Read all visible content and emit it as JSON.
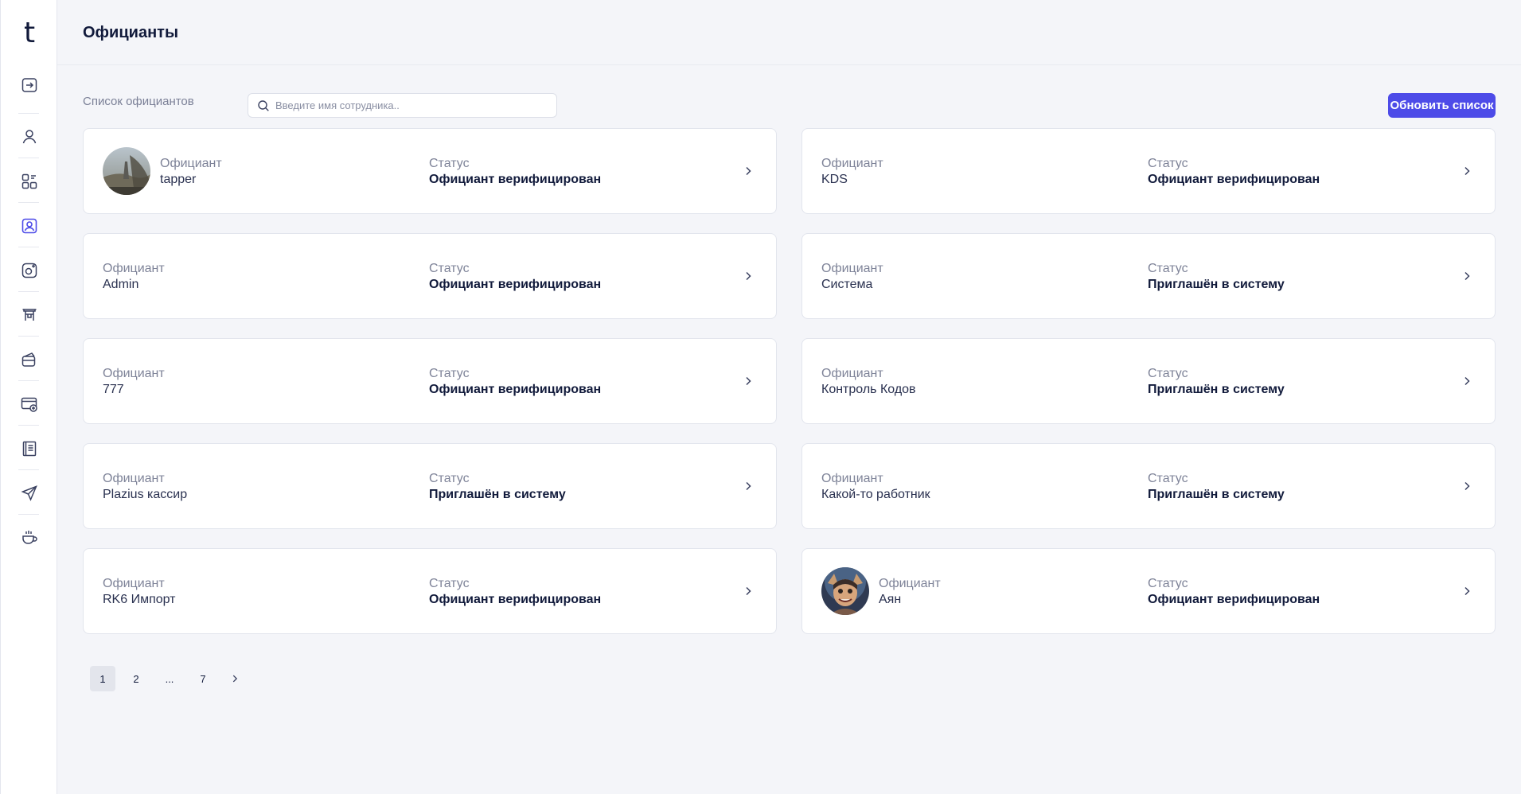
{
  "app": {
    "logo": "t"
  },
  "header": {
    "title": "Официанты"
  },
  "toolbar": {
    "list_label": "Список официантов",
    "search_placeholder": "Введите имя сотрудника..",
    "refresh_label": "Обновить список"
  },
  "sidebar": {
    "items": [
      {
        "icon": "logout-icon"
      },
      {
        "icon": "user-icon"
      },
      {
        "icon": "dashboard-icon"
      },
      {
        "icon": "waiters-icon",
        "active": true
      },
      {
        "icon": "restaurant-settings-icon"
      },
      {
        "icon": "tables-icon"
      },
      {
        "icon": "payments-icon"
      },
      {
        "icon": "card-add-icon"
      },
      {
        "icon": "menu-book-icon"
      },
      {
        "icon": "send-icon"
      },
      {
        "icon": "cup-icon"
      }
    ]
  },
  "cards": [
    {
      "label": "Официант",
      "name": "tapper",
      "status_label": "Статус",
      "status": "Официант верифицирован",
      "avatar": "photo-bench"
    },
    {
      "label": "Официант",
      "name": "KDS",
      "status_label": "Статус",
      "status": "Официант верифицирован"
    },
    {
      "label": "Официант",
      "name": "Admin",
      "status_label": "Статус",
      "status": "Официант верифицирован"
    },
    {
      "label": "Официант",
      "name": "Система",
      "status_label": "Статус",
      "status": "Приглашён в систему"
    },
    {
      "label": "Официант",
      "name": "777",
      "status_label": "Статус",
      "status": "Официант верифицирован"
    },
    {
      "label": "Официант",
      "name": "Контроль Кодов",
      "status_label": "Статус",
      "status": "Приглашён в систему"
    },
    {
      "label": "Официант",
      "name": "Plazius кассир",
      "status_label": "Статус",
      "status": "Приглашён в систему"
    },
    {
      "label": "Официант",
      "name": "Какой-то работник",
      "status_label": "Статус",
      "status": "Приглашён в систему"
    },
    {
      "label": "Официант",
      "name": "RK6 Импорт",
      "status_label": "Статус",
      "status": "Официант верифицирован"
    },
    {
      "label": "Официант",
      "name": "Аян",
      "status_label": "Статус",
      "status": "Официант верифицирован",
      "avatar": "photo-character"
    }
  ],
  "pagination": {
    "pages": [
      "1",
      "2",
      "...",
      "7"
    ],
    "current": "1"
  },
  "colors": {
    "accent": "#4d4be8",
    "text": "#111a3b",
    "muted": "#7e8398",
    "background": "#f4f5f9"
  }
}
